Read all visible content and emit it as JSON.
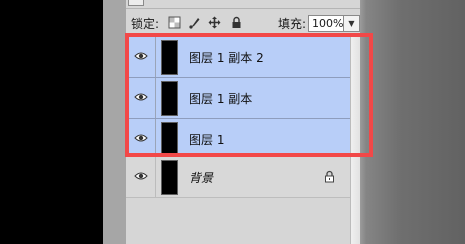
{
  "toolbar": {
    "lock_label": "锁定:",
    "fill_label": "填充:",
    "fill_value": "100%",
    "fill_dropdown_glyph": "▼"
  },
  "layers": [
    {
      "name": "图层 1 副本 2",
      "selected": true,
      "visible": true
    },
    {
      "name": "图层 1 副本",
      "selected": true,
      "visible": true
    },
    {
      "name": "图层 1",
      "selected": true,
      "visible": true
    },
    {
      "name": "背景",
      "selected": false,
      "visible": true,
      "locked": true
    }
  ],
  "colors": {
    "selection": "#b8cef8",
    "highlight_box": "#f24848",
    "panel": "#d6d6d6"
  }
}
